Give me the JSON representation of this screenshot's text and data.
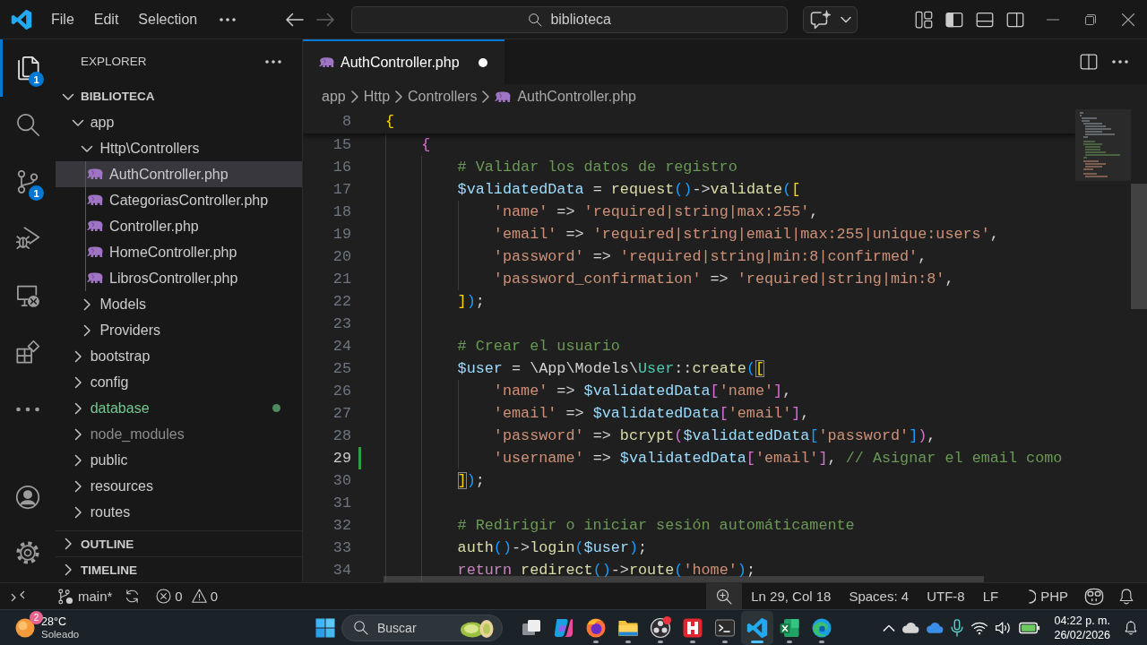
{
  "title_bar": {
    "menus": [
      "File",
      "Edit",
      "Selection"
    ],
    "navigation": [
      {
        "kind": "back",
        "disabled": false
      },
      {
        "kind": "forward",
        "disabled": true
      }
    ],
    "command_center": "biblioteca",
    "layout_toggles": [
      {
        "kind": "primary-sidebar",
        "on": true
      },
      {
        "kind": "panel",
        "on": false
      },
      {
        "kind": "secondary-sidebar",
        "on": false
      }
    ]
  },
  "activity_bar": {
    "items": [
      {
        "kind": "explorer",
        "selected": true,
        "badge": "1"
      },
      {
        "kind": "search",
        "selected": false
      },
      {
        "kind": "source-control",
        "selected": false,
        "badge": "1"
      },
      {
        "kind": "run-debug",
        "selected": false
      },
      {
        "kind": "remote-explorer",
        "selected": false
      },
      {
        "kind": "extensions",
        "selected": false
      },
      {
        "kind": "more",
        "selected": false
      }
    ],
    "bottom_items": [
      {
        "kind": "accounts"
      },
      {
        "kind": "settings"
      }
    ]
  },
  "sidebar": {
    "title": "EXPLORER",
    "root": {
      "label": "BIBLIOTECA",
      "expanded": true,
      "children": [
        {
          "label": "app",
          "kind": "folder",
          "expanded": true,
          "selected": false,
          "untracked": false,
          "ignored": false,
          "children": [
            {
              "label": "Http\\Controllers",
              "kind": "folder",
              "expanded": true,
              "selected": false,
              "untracked": false,
              "ignored": false,
              "children": [
                {
                  "label": "AuthController.php",
                  "kind": "file",
                  "selected": true,
                  "untracked": false,
                  "ignored": false
                },
                {
                  "label": "CategoriasController.php",
                  "kind": "file",
                  "selected": false,
                  "untracked": false,
                  "ignored": false
                },
                {
                  "label": "Controller.php",
                  "kind": "file",
                  "selected": false,
                  "untracked": false,
                  "ignored": false
                },
                {
                  "label": "HomeController.php",
                  "kind": "file",
                  "selected": false,
                  "untracked": false,
                  "ignored": false
                },
                {
                  "label": "LibrosController.php",
                  "kind": "file",
                  "selected": false,
                  "untracked": false,
                  "ignored": false
                }
              ]
            },
            {
              "label": "Models",
              "kind": "folder",
              "expanded": false,
              "selected": false,
              "untracked": false,
              "ignored": false
            },
            {
              "label": "Providers",
              "kind": "folder",
              "expanded": false,
              "selected": false,
              "untracked": false,
              "ignored": false
            }
          ]
        },
        {
          "label": "bootstrap",
          "kind": "folder",
          "expanded": false,
          "selected": false,
          "untracked": false,
          "ignored": false
        },
        {
          "label": "config",
          "kind": "folder",
          "expanded": false,
          "selected": false,
          "untracked": false,
          "ignored": false
        },
        {
          "label": "database",
          "kind": "folder",
          "expanded": false,
          "selected": false,
          "untracked": true,
          "ignored": false
        },
        {
          "label": "node_modules",
          "kind": "folder",
          "expanded": false,
          "selected": false,
          "untracked": false,
          "ignored": true
        },
        {
          "label": "public",
          "kind": "folder",
          "expanded": false,
          "selected": false,
          "untracked": false,
          "ignored": false
        },
        {
          "label": "resources",
          "kind": "folder",
          "expanded": false,
          "selected": false,
          "untracked": false,
          "ignored": false
        },
        {
          "label": "routes",
          "kind": "folder",
          "expanded": false,
          "selected": false,
          "untracked": false,
          "ignored": false
        }
      ]
    },
    "sections": [
      {
        "label": "OUTLINE",
        "expanded": false
      },
      {
        "label": "TIMELINE",
        "expanded": false
      }
    ]
  },
  "editor": {
    "tabs": [
      {
        "label": "AuthController.php",
        "selected": true,
        "dirty": true
      }
    ],
    "breadcrumbs": [
      "app",
      "Http",
      "Controllers",
      "AuthController.php"
    ],
    "sticky_lines": [
      {
        "number": "8",
        "tokens": [
          {
            "kind": "bracket-gold",
            "text": "{"
          }
        ]
      }
    ],
    "lines": [
      {
        "number": "15",
        "current": false,
        "added": false,
        "tokens": [
          {
            "kind": "bracket-orchid",
            "text": "    {"
          }
        ]
      },
      {
        "number": "16",
        "current": false,
        "added": false,
        "tokens": [
          {
            "kind": "comment",
            "text": "        # Validar los datos de registro"
          }
        ]
      },
      {
        "number": "17",
        "current": false,
        "added": false,
        "tokens": [
          {
            "kind": "variable",
            "text": "        $validatedData"
          },
          {
            "kind": "plain",
            "text": " = "
          },
          {
            "kind": "function",
            "text": "request"
          },
          {
            "kind": "bracket-blue",
            "text": "()"
          },
          {
            "kind": "plain",
            "text": "->"
          },
          {
            "kind": "function",
            "text": "validate"
          },
          {
            "kind": "bracket-blue",
            "text": "("
          },
          {
            "kind": "bracket-gold",
            "text": "["
          }
        ]
      },
      {
        "number": "18",
        "current": false,
        "added": false,
        "tokens": [
          {
            "kind": "string",
            "text": "            'name'"
          },
          {
            "kind": "plain",
            "text": " => "
          },
          {
            "kind": "string",
            "text": "'required|string|max:255'"
          },
          {
            "kind": "plain",
            "text": ","
          }
        ]
      },
      {
        "number": "19",
        "current": false,
        "added": false,
        "tokens": [
          {
            "kind": "string",
            "text": "            'email'"
          },
          {
            "kind": "plain",
            "text": " => "
          },
          {
            "kind": "string",
            "text": "'required|string|email|max:255|unique:users'"
          },
          {
            "kind": "plain",
            "text": ","
          }
        ]
      },
      {
        "number": "20",
        "current": false,
        "added": false,
        "tokens": [
          {
            "kind": "string",
            "text": "            'password'"
          },
          {
            "kind": "plain",
            "text": " => "
          },
          {
            "kind": "string",
            "text": "'required|string|min:8|confirmed'"
          },
          {
            "kind": "plain",
            "text": ","
          }
        ]
      },
      {
        "number": "21",
        "current": false,
        "added": false,
        "tokens": [
          {
            "kind": "string",
            "text": "            'password_confirmation'"
          },
          {
            "kind": "plain",
            "text": " => "
          },
          {
            "kind": "string",
            "text": "'required|string|min:8'"
          },
          {
            "kind": "plain",
            "text": ","
          }
        ]
      },
      {
        "number": "22",
        "current": false,
        "added": false,
        "tokens": [
          {
            "kind": "bracket-gold",
            "text": "        ]"
          },
          {
            "kind": "bracket-blue",
            "text": ")"
          },
          {
            "kind": "plain",
            "text": ";"
          }
        ]
      },
      {
        "number": "23",
        "current": false,
        "added": false
      },
      {
        "number": "24",
        "current": false,
        "added": false,
        "tokens": [
          {
            "kind": "comment",
            "text": "        # Crear el usuario"
          }
        ]
      },
      {
        "number": "25",
        "current": false,
        "added": false,
        "tokens": [
          {
            "kind": "variable",
            "text": "        $user"
          },
          {
            "kind": "plain",
            "text": " = \\App\\Models\\"
          },
          {
            "kind": "class",
            "text": "User"
          },
          {
            "kind": "plain",
            "text": "::"
          },
          {
            "kind": "function",
            "text": "create"
          },
          {
            "kind": "bracket-blue",
            "text": "("
          },
          {
            "kind": "bracket-match",
            "text": "["
          }
        ]
      },
      {
        "number": "26",
        "current": false,
        "added": false,
        "tokens": [
          {
            "kind": "string",
            "text": "            'name'"
          },
          {
            "kind": "plain",
            "text": " => "
          },
          {
            "kind": "variable",
            "text": "$validatedData"
          },
          {
            "kind": "bracket-orchid",
            "text": "["
          },
          {
            "kind": "string",
            "text": "'name'"
          },
          {
            "kind": "bracket-orchid",
            "text": "]"
          },
          {
            "kind": "plain",
            "text": ","
          }
        ]
      },
      {
        "number": "27",
        "current": false,
        "added": false,
        "tokens": [
          {
            "kind": "string",
            "text": "            'email'"
          },
          {
            "kind": "plain",
            "text": " => "
          },
          {
            "kind": "variable",
            "text": "$validatedData"
          },
          {
            "kind": "bracket-orchid",
            "text": "["
          },
          {
            "kind": "string",
            "text": "'email'"
          },
          {
            "kind": "bracket-orchid",
            "text": "]"
          },
          {
            "kind": "plain",
            "text": ","
          }
        ]
      },
      {
        "number": "28",
        "current": false,
        "added": false,
        "tokens": [
          {
            "kind": "string",
            "text": "            'password'"
          },
          {
            "kind": "plain",
            "text": " => "
          },
          {
            "kind": "function",
            "text": "bcrypt"
          },
          {
            "kind": "bracket-orchid",
            "text": "("
          },
          {
            "kind": "variable",
            "text": "$validatedData"
          },
          {
            "kind": "bracket-blue",
            "text": "["
          },
          {
            "kind": "string",
            "text": "'password'"
          },
          {
            "kind": "bracket-blue",
            "text": "]"
          },
          {
            "kind": "bracket-orchid",
            "text": ")"
          },
          {
            "kind": "plain",
            "text": ","
          }
        ]
      },
      {
        "number": "29",
        "current": true,
        "added": true,
        "tokens": [
          {
            "kind": "string",
            "text": "            'username'"
          },
          {
            "kind": "plain",
            "text": " => "
          },
          {
            "kind": "variable",
            "text": "$validatedData"
          },
          {
            "kind": "bracket-orchid",
            "text": "["
          },
          {
            "kind": "string",
            "text": "'email'"
          },
          {
            "kind": "bracket-orchid",
            "text": "]"
          },
          {
            "kind": "plain",
            "text": ", "
          },
          {
            "kind": "comment",
            "text": "// Asignar el email como"
          }
        ]
      },
      {
        "number": "30",
        "current": false,
        "added": false,
        "tokens": [
          {
            "kind": "bracket-match",
            "text": "        ]"
          },
          {
            "kind": "bracket-blue",
            "text": ")"
          },
          {
            "kind": "plain",
            "text": ";"
          }
        ]
      },
      {
        "number": "31",
        "current": false,
        "added": false
      },
      {
        "number": "32",
        "current": false,
        "added": false,
        "tokens": [
          {
            "kind": "comment",
            "text": "        # Redirigir o iniciar sesión automáticamente"
          }
        ]
      },
      {
        "number": "33",
        "current": false,
        "added": false,
        "tokens": [
          {
            "kind": "function",
            "text": "        auth"
          },
          {
            "kind": "bracket-blue",
            "text": "()"
          },
          {
            "kind": "plain",
            "text": "->"
          },
          {
            "kind": "function",
            "text": "login"
          },
          {
            "kind": "bracket-blue",
            "text": "("
          },
          {
            "kind": "variable",
            "text": "$user"
          },
          {
            "kind": "bracket-blue",
            "text": ")"
          },
          {
            "kind": "plain",
            "text": ";"
          }
        ]
      },
      {
        "number": "34",
        "current": false,
        "added": false,
        "tokens": [
          {
            "kind": "keyword",
            "text": "        return "
          },
          {
            "kind": "function",
            "text": "redirect"
          },
          {
            "kind": "bracket-blue",
            "text": "()"
          },
          {
            "kind": "plain",
            "text": "->"
          },
          {
            "kind": "function",
            "text": "route"
          },
          {
            "kind": "bracket-blue",
            "text": "("
          },
          {
            "kind": "string",
            "text": "'home'"
          },
          {
            "kind": "bracket-blue",
            "text": ")"
          },
          {
            "kind": "plain",
            "text": ";"
          }
        ]
      }
    ]
  },
  "status_bar": {
    "branch": "main*",
    "errors": "0",
    "warnings": "0",
    "cursor": "Ln 29, Col 18",
    "indentation": "Spaces: 4",
    "encoding": "UTF-8",
    "line_ending": "LF",
    "language": "PHP",
    "language_loading": true
  },
  "taskbar": {
    "weather": {
      "badge": "2",
      "temperature": "28°C",
      "condition": "Soleado"
    },
    "search": {
      "placeholder": "Buscar"
    },
    "apps": [
      {
        "kind": "task-view",
        "running": false,
        "selected": false,
        "alert": false
      },
      {
        "kind": "m365",
        "running": false,
        "selected": false,
        "alert": false
      },
      {
        "kind": "firefox",
        "running": true,
        "selected": false,
        "alert": false
      },
      {
        "kind": "files",
        "running": true,
        "selected": false,
        "alert": false
      },
      {
        "kind": "obs",
        "running": true,
        "selected": false,
        "alert": true
      },
      {
        "kind": "h-app",
        "running": true,
        "selected": false,
        "alert": false
      },
      {
        "kind": "terminal",
        "running": true,
        "selected": false,
        "alert": false
      },
      {
        "kind": "vscode",
        "running": true,
        "selected": true,
        "alert": false
      },
      {
        "kind": "excel",
        "running": true,
        "selected": false,
        "alert": false
      },
      {
        "kind": "edge",
        "running": true,
        "selected": false,
        "alert": false
      }
    ],
    "clock": {
      "time": "04:22 p. m.",
      "date": "26/02/2026"
    }
  }
}
